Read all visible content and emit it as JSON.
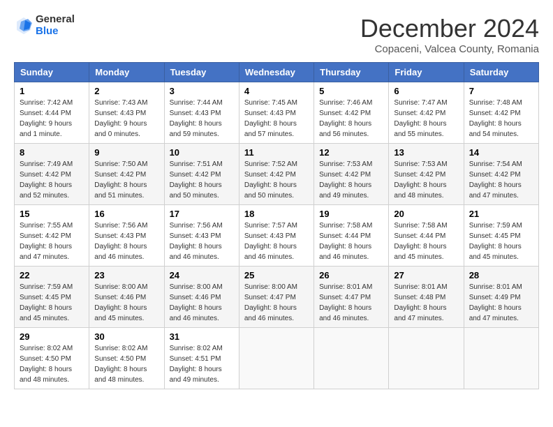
{
  "logo": {
    "line1": "General",
    "line2": "Blue"
  },
  "title": "December 2024",
  "subtitle": "Copaceni, Valcea County, Romania",
  "days_of_week": [
    "Sunday",
    "Monday",
    "Tuesday",
    "Wednesday",
    "Thursday",
    "Friday",
    "Saturday"
  ],
  "weeks": [
    [
      {
        "day": "1",
        "sunrise": "7:42 AM",
        "sunset": "4:44 PM",
        "daylight": "9 hours and 1 minute."
      },
      {
        "day": "2",
        "sunrise": "7:43 AM",
        "sunset": "4:43 PM",
        "daylight": "9 hours and 0 minutes."
      },
      {
        "day": "3",
        "sunrise": "7:44 AM",
        "sunset": "4:43 PM",
        "daylight": "8 hours and 59 minutes."
      },
      {
        "day": "4",
        "sunrise": "7:45 AM",
        "sunset": "4:43 PM",
        "daylight": "8 hours and 57 minutes."
      },
      {
        "day": "5",
        "sunrise": "7:46 AM",
        "sunset": "4:42 PM",
        "daylight": "8 hours and 56 minutes."
      },
      {
        "day": "6",
        "sunrise": "7:47 AM",
        "sunset": "4:42 PM",
        "daylight": "8 hours and 55 minutes."
      },
      {
        "day": "7",
        "sunrise": "7:48 AM",
        "sunset": "4:42 PM",
        "daylight": "8 hours and 54 minutes."
      }
    ],
    [
      {
        "day": "8",
        "sunrise": "7:49 AM",
        "sunset": "4:42 PM",
        "daylight": "8 hours and 52 minutes."
      },
      {
        "day": "9",
        "sunrise": "7:50 AM",
        "sunset": "4:42 PM",
        "daylight": "8 hours and 51 minutes."
      },
      {
        "day": "10",
        "sunrise": "7:51 AM",
        "sunset": "4:42 PM",
        "daylight": "8 hours and 50 minutes."
      },
      {
        "day": "11",
        "sunrise": "7:52 AM",
        "sunset": "4:42 PM",
        "daylight": "8 hours and 50 minutes."
      },
      {
        "day": "12",
        "sunrise": "7:53 AM",
        "sunset": "4:42 PM",
        "daylight": "8 hours and 49 minutes."
      },
      {
        "day": "13",
        "sunrise": "7:53 AM",
        "sunset": "4:42 PM",
        "daylight": "8 hours and 48 minutes."
      },
      {
        "day": "14",
        "sunrise": "7:54 AM",
        "sunset": "4:42 PM",
        "daylight": "8 hours and 47 minutes."
      }
    ],
    [
      {
        "day": "15",
        "sunrise": "7:55 AM",
        "sunset": "4:42 PM",
        "daylight": "8 hours and 47 minutes."
      },
      {
        "day": "16",
        "sunrise": "7:56 AM",
        "sunset": "4:43 PM",
        "daylight": "8 hours and 46 minutes."
      },
      {
        "day": "17",
        "sunrise": "7:56 AM",
        "sunset": "4:43 PM",
        "daylight": "8 hours and 46 minutes."
      },
      {
        "day": "18",
        "sunrise": "7:57 AM",
        "sunset": "4:43 PM",
        "daylight": "8 hours and 46 minutes."
      },
      {
        "day": "19",
        "sunrise": "7:58 AM",
        "sunset": "4:44 PM",
        "daylight": "8 hours and 46 minutes."
      },
      {
        "day": "20",
        "sunrise": "7:58 AM",
        "sunset": "4:44 PM",
        "daylight": "8 hours and 45 minutes."
      },
      {
        "day": "21",
        "sunrise": "7:59 AM",
        "sunset": "4:45 PM",
        "daylight": "8 hours and 45 minutes."
      }
    ],
    [
      {
        "day": "22",
        "sunrise": "7:59 AM",
        "sunset": "4:45 PM",
        "daylight": "8 hours and 45 minutes."
      },
      {
        "day": "23",
        "sunrise": "8:00 AM",
        "sunset": "4:46 PM",
        "daylight": "8 hours and 45 minutes."
      },
      {
        "day": "24",
        "sunrise": "8:00 AM",
        "sunset": "4:46 PM",
        "daylight": "8 hours and 46 minutes."
      },
      {
        "day": "25",
        "sunrise": "8:00 AM",
        "sunset": "4:47 PM",
        "daylight": "8 hours and 46 minutes."
      },
      {
        "day": "26",
        "sunrise": "8:01 AM",
        "sunset": "4:47 PM",
        "daylight": "8 hours and 46 minutes."
      },
      {
        "day": "27",
        "sunrise": "8:01 AM",
        "sunset": "4:48 PM",
        "daylight": "8 hours and 47 minutes."
      },
      {
        "day": "28",
        "sunrise": "8:01 AM",
        "sunset": "4:49 PM",
        "daylight": "8 hours and 47 minutes."
      }
    ],
    [
      {
        "day": "29",
        "sunrise": "8:02 AM",
        "sunset": "4:50 PM",
        "daylight": "8 hours and 48 minutes."
      },
      {
        "day": "30",
        "sunrise": "8:02 AM",
        "sunset": "4:50 PM",
        "daylight": "8 hours and 48 minutes."
      },
      {
        "day": "31",
        "sunrise": "8:02 AM",
        "sunset": "4:51 PM",
        "daylight": "8 hours and 49 minutes."
      },
      null,
      null,
      null,
      null
    ]
  ]
}
